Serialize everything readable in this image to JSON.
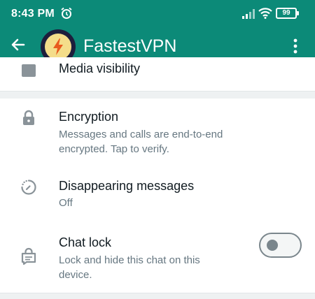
{
  "status_bar": {
    "time": "8:43 PM",
    "battery": "99"
  },
  "header": {
    "title": "FastestVPN"
  },
  "settings": {
    "media_visibility": "Media visibility",
    "encryption": {
      "title": "Encryption",
      "subtitle_line1": "Messages and calls are end-to-end",
      "subtitle_line2": "encrypted. Tap to verify."
    },
    "disappearing": {
      "title": "Disappearing messages",
      "value": "Off"
    },
    "chat_lock": {
      "title": "Chat lock",
      "subtitle_line1": "Lock and hide this chat on this",
      "subtitle_line2": "device.",
      "enabled": false
    }
  },
  "colors": {
    "header": "#0c8a78",
    "primary_text": "#111b21",
    "secondary_text": "#667781",
    "icon": "#8a9399"
  }
}
